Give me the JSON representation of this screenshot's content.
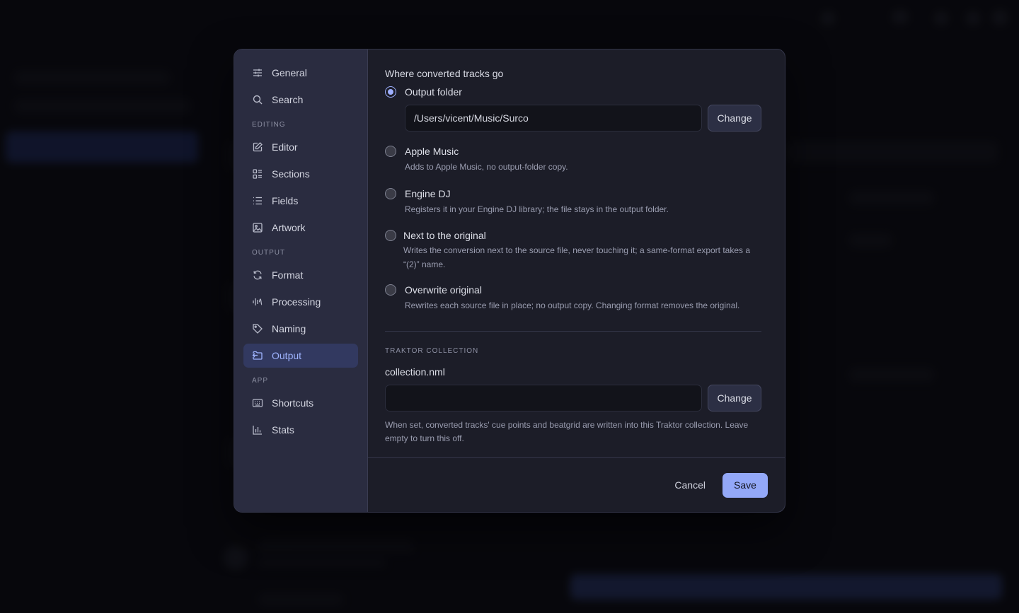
{
  "sidebar": {
    "items": [
      {
        "label": "General",
        "icon": "sliders-icon"
      },
      {
        "label": "Search",
        "icon": "search-icon"
      }
    ],
    "sections": [
      {
        "label": "EDITING",
        "items": [
          {
            "label": "Editor",
            "icon": "edit-icon"
          },
          {
            "label": "Sections",
            "icon": "sections-icon"
          },
          {
            "label": "Fields",
            "icon": "list-icon"
          },
          {
            "label": "Artwork",
            "icon": "image-icon"
          }
        ]
      },
      {
        "label": "OUTPUT",
        "items": [
          {
            "label": "Format",
            "icon": "refresh-icon"
          },
          {
            "label": "Processing",
            "icon": "waveform-icon"
          },
          {
            "label": "Naming",
            "icon": "tag-icon"
          },
          {
            "label": "Output",
            "icon": "output-icon"
          }
        ]
      },
      {
        "label": "APP",
        "items": [
          {
            "label": "Shortcuts",
            "icon": "keyboard-icon"
          },
          {
            "label": "Stats",
            "icon": "bar-chart-icon"
          }
        ]
      }
    ],
    "active": "Output"
  },
  "destination": {
    "title": "Where converted tracks go",
    "options": [
      {
        "label": "Output folder",
        "desc": "",
        "checked": true
      },
      {
        "label": "Apple Music",
        "desc": "Adds to Apple Music, no output-folder copy.",
        "checked": false
      },
      {
        "label": "Engine DJ",
        "desc": "Registers it in your Engine DJ library; the file stays in the output folder.",
        "checked": false
      },
      {
        "label": "Next to the original",
        "desc": "Writes the conversion next to the source file, never touching it; a same-format export takes a “(2)” name.",
        "checked": false
      },
      {
        "label": "Overwrite original",
        "desc": "Rewrites each source file in place; no output copy. Changing format removes the original.",
        "checked": false
      }
    ],
    "output_path": "/Users/vicent/Music/Surco",
    "change_label": "Change"
  },
  "traktor": {
    "section_label": "TRAKTOR COLLECTION",
    "field_label": "collection.nml",
    "value": "",
    "change_label": "Change",
    "help": "When set, converted tracks' cue points and beatgrid are written into this Traktor collection. Leave empty to turn this off."
  },
  "footer": {
    "cancel_label": "Cancel",
    "save_label": "Save"
  },
  "colors": {
    "accent": "#93a8f8",
    "active_nav_bg": "#323960",
    "modal_bg": "#1c1d28",
    "sidebar_bg": "#2a2c40"
  }
}
